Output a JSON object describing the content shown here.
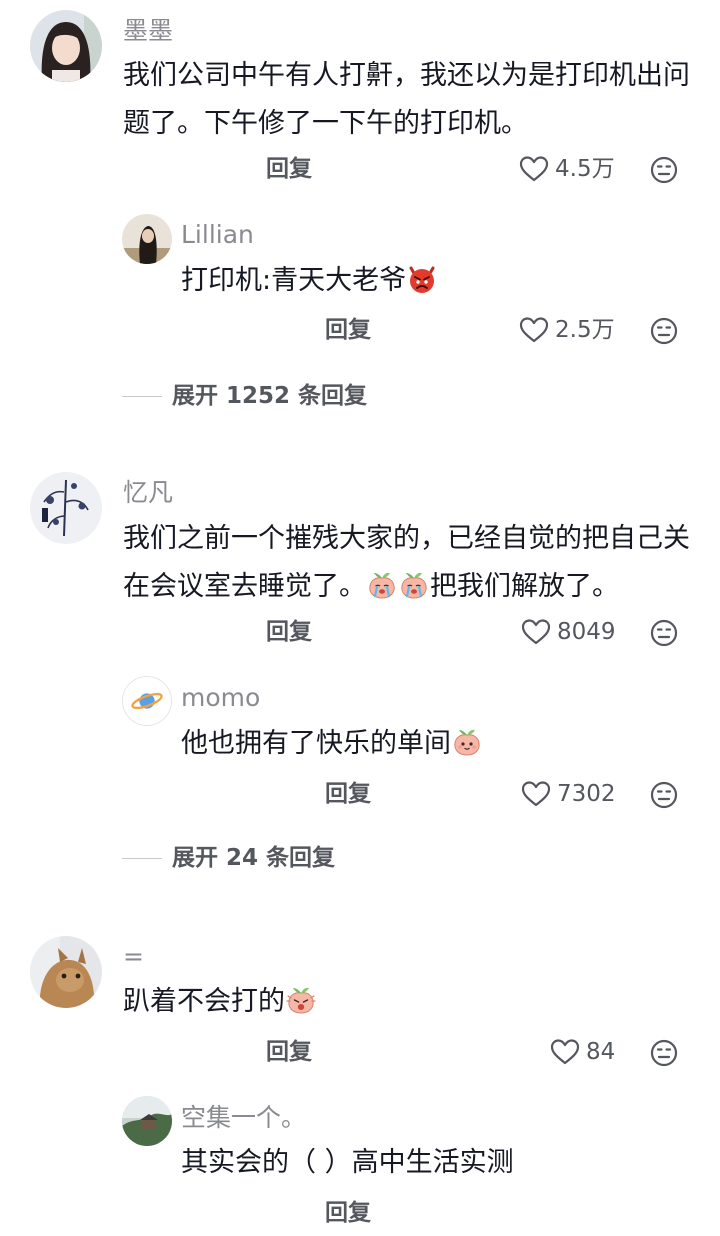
{
  "comments": [
    {
      "user": "墨墨",
      "text": "我们公司中午有人打鼾，我还以为是打印机出问题了。下午修了一下午的打印机。",
      "reply_label": "回复",
      "likes": "4.5万",
      "reply": {
        "user": "Lillian",
        "text": "打印机:青天大老爷",
        "emoji": "angry-devil-emoji",
        "reply_label": "回复",
        "likes": "2.5万"
      },
      "expand_label": "展开 1252 条回复"
    },
    {
      "user": "忆凡",
      "text_part1": "我们之前一个摧残大家的，已经自觉的把自己关在会议室去睡觉了。",
      "emoji": "crying-peach-emoji",
      "text_part2": "把我们解放了。",
      "reply_label": "回复",
      "likes": "8049",
      "reply": {
        "user": "momo",
        "text": "他也拥有了快乐的单间",
        "emoji": "peach-emoji",
        "reply_label": "回复",
        "likes": "7302"
      },
      "expand_label": "展开 24 条回复"
    },
    {
      "user": "=",
      "text": "趴着不会打的",
      "emoji": "shouting-peach-emoji",
      "reply_label": "回复",
      "likes": "84",
      "reply": {
        "user": "空集一个。",
        "text": "其实会的（ ）高中生活实测",
        "reply_label": "回复"
      }
    }
  ],
  "colors": {
    "text": "#161823",
    "secondary": "#8a8b91",
    "action": "#55575e"
  }
}
